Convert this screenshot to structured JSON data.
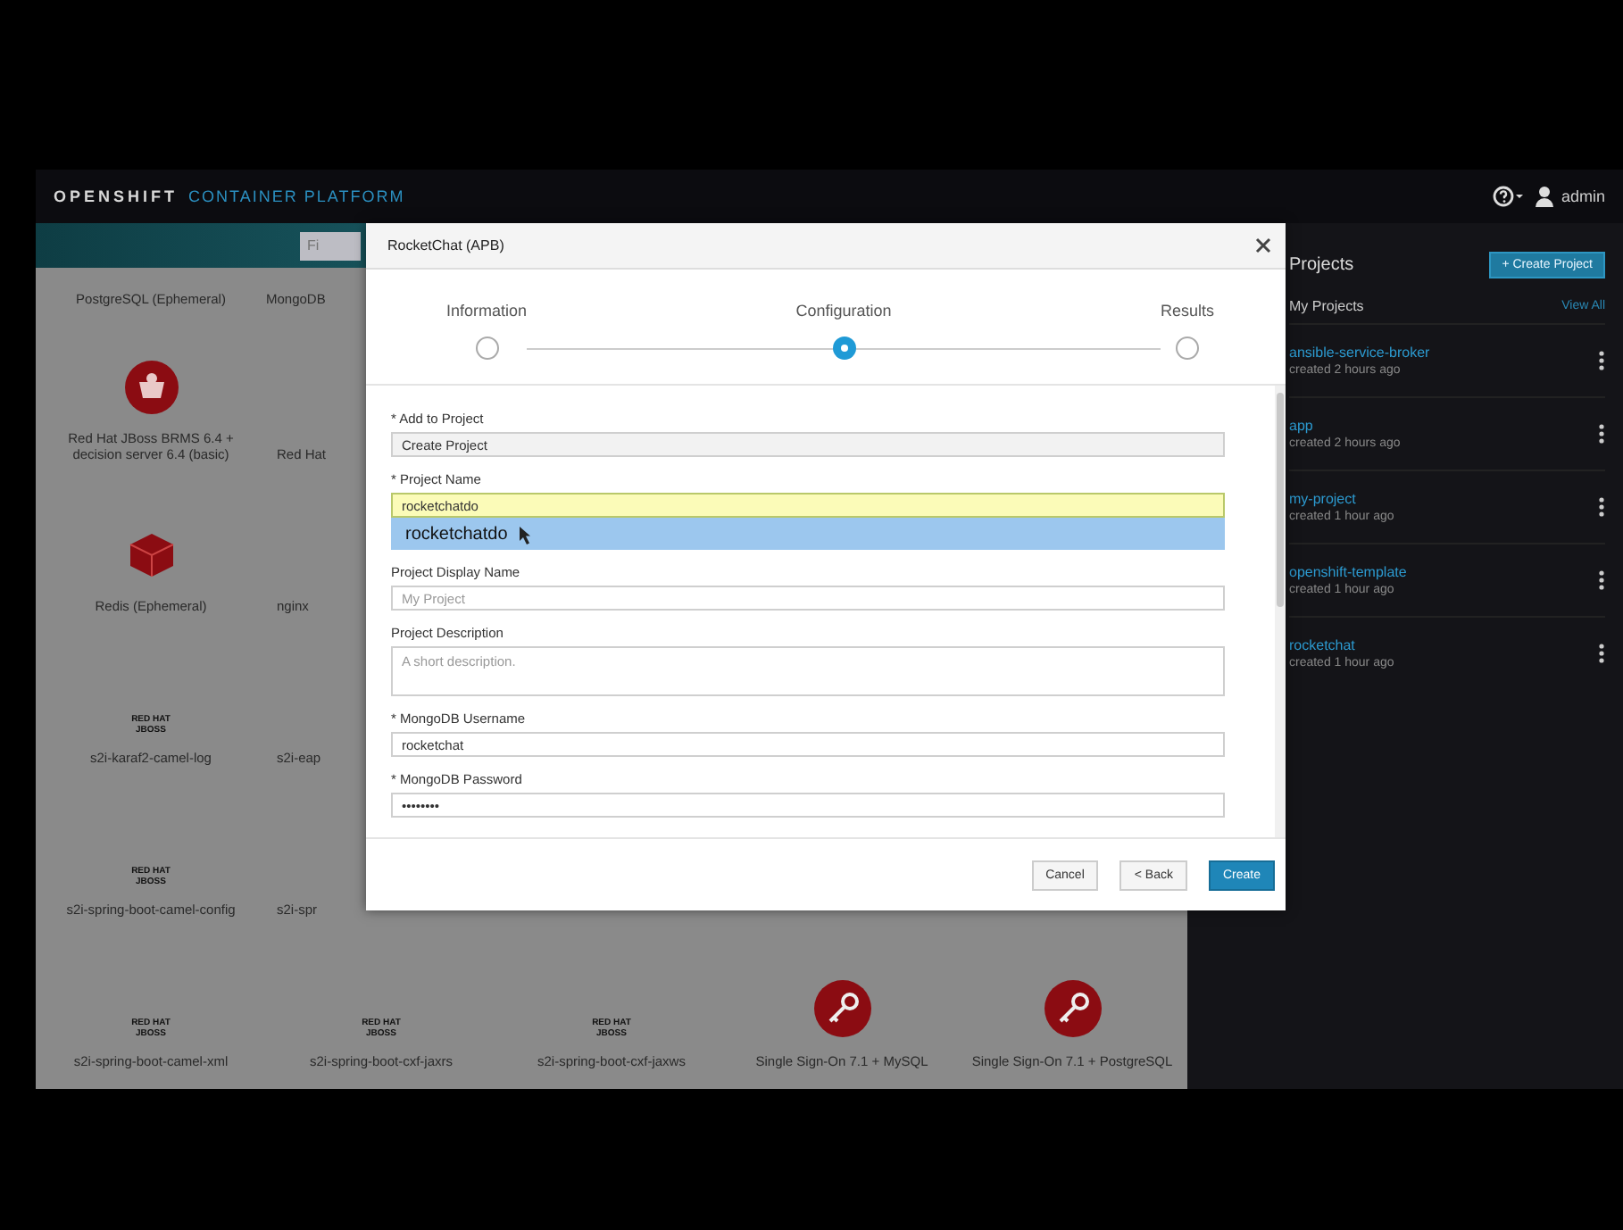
{
  "masthead": {
    "brand": "OPENSHIFT",
    "product": "CONTAINER PLATFORM",
    "user": "admin"
  },
  "catalog": {
    "search": {
      "placeholder": "Fi"
    },
    "rows": [
      {
        "tiles": [
          {
            "kind": "plain",
            "name": "PostgreSQL (Ephemeral)"
          },
          {
            "kind": "plain",
            "name": "MongoDB"
          }
        ]
      },
      {
        "tiles": [
          {
            "kind": "badge",
            "name": "Red Hat JBoss BRMS 6.4 + decision server 6.4 (basic)"
          },
          {
            "kind": "plain",
            "name": "Red Hat"
          }
        ]
      },
      {
        "tiles": [
          {
            "kind": "cube",
            "name": "Redis (Ephemeral)"
          },
          {
            "kind": "plain",
            "name": "nginx"
          }
        ]
      },
      {
        "tiles": [
          {
            "kind": "logo",
            "logo_text": "RED HAT JBOSS",
            "name": "s2i-karaf2-camel-log"
          },
          {
            "kind": "plain",
            "name": "s2i-eap"
          }
        ]
      },
      {
        "tiles": [
          {
            "kind": "logo",
            "logo_text": "RED HAT JBOSS",
            "name": "s2i-spring-boot-camel-config"
          },
          {
            "kind": "plain",
            "name": "s2i-spr"
          }
        ]
      },
      {
        "tiles": [
          {
            "kind": "logo",
            "logo_text": "RED HAT JBOSS",
            "name": "s2i-spring-boot-camel-xml"
          },
          {
            "kind": "logo",
            "logo_text": "RED HAT JBOSS",
            "name": "s2i-spring-boot-cxf-jaxrs"
          },
          {
            "kind": "logo",
            "logo_text": "RED HAT JBOSS",
            "name": "s2i-spring-boot-cxf-jaxws"
          },
          {
            "kind": "key",
            "name": "Single Sign-On 7.1 + MySQL"
          },
          {
            "kind": "key",
            "name": "Single Sign-On 7.1 + PostgreSQL"
          }
        ]
      }
    ]
  },
  "projects": {
    "title": "Projects",
    "create_button": "+ Create Project",
    "list_title": "My Projects",
    "view_all": "View All",
    "items": [
      {
        "name": "ansible-service-broker",
        "subtitle": "created 2 hours ago"
      },
      {
        "name": "app",
        "subtitle": "created 2 hours ago"
      },
      {
        "name": "my-project",
        "subtitle": "created 1 hour ago"
      },
      {
        "name": "openshift-template",
        "subtitle": "created 1 hour ago"
      },
      {
        "name": "rocketchat",
        "subtitle": "created 1 hour ago"
      }
    ]
  },
  "wizard": {
    "title": "RocketChat (APB)",
    "steps": [
      {
        "label": "Information",
        "selected": false
      },
      {
        "label": "Configuration",
        "selected": true
      },
      {
        "label": "Results",
        "selected": false
      }
    ],
    "fields": [
      {
        "kind": "select",
        "label": "* Add to Project",
        "value": "Create Project"
      },
      {
        "kind": "input",
        "label": "* Project Name",
        "value": "rocketchatdo",
        "autofilled": true,
        "suggestion": "rocketchatdo"
      },
      {
        "kind": "input",
        "label": "Project Display Name",
        "placeholder": "My Project"
      },
      {
        "kind": "textarea",
        "label": "Project Description",
        "placeholder": "A short description."
      },
      {
        "kind": "input",
        "label": "* MongoDB Username",
        "value": "rocketchat"
      },
      {
        "kind": "input",
        "label": "* MongoDB Password",
        "value": "••••••••"
      }
    ],
    "buttons": [
      {
        "label": "Cancel",
        "primary": false
      },
      {
        "label": "< Back",
        "primary": false
      },
      {
        "label": "Create",
        "primary": true
      }
    ]
  }
}
